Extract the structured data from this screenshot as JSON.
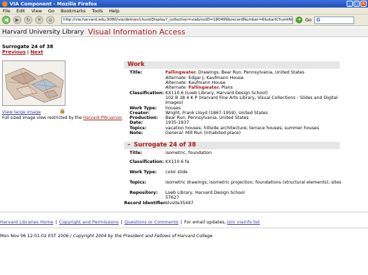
{
  "window": {
    "title": "VIA Component - Mozilla Firefox"
  },
  "menu": [
    "File",
    "Edit",
    "View",
    "Go",
    "Bookmarks",
    "Tools",
    "Help"
  ],
  "toolbar": {
    "url": "http://via.harvard.edu:9080/via/deliver/chunkDisplay?_collection=via&inoID=180499&recordNumber=6&startChunkNum=1&endChunkNum=3&&c",
    "go_label": "Go"
  },
  "header": {
    "library": "Harvard University Library",
    "app": "Visual Information Access"
  },
  "surrogate": {
    "title": "Surrogate 24 of 38",
    "previous": "Previous",
    "separator": "|",
    "next": "Next"
  },
  "thumbnail": {
    "view_large": "View large image",
    "restricted_text": "Full sized image view restricted by the ",
    "restricted_link": "Harvard PIN server"
  },
  "work": {
    "heading": "Work",
    "title_label": "Title:",
    "title_main_red": "Fallingwater.",
    "title_main_rest": " Drawings, Bear Run, Pennsylvania, United States",
    "alt_label": "Alternate:",
    "alt1": " Edgar J. Kaufmann House",
    "alt2": " Kaufmann House",
    "alt3_red": " Fallingwater.",
    "alt3_rest": " Plans",
    "classification_label": "Classification:",
    "classification_1": "KX110.6 (Loeb Library, Harvard Design School)",
    "classification_2": "102 B 38 4 K P (Harvard Fine Arts Library, Visual Collections - Slides and Digital",
    "classification_3": "Images)",
    "work_type_label": "Work Type:",
    "work_type": "houses",
    "creator_label": "Creator:",
    "creator": "Wright, Frank Lloyd (1867-1959), United States",
    "production_label": "Production:",
    "production": "Bear Run, Pennsylvania, United States",
    "date_label": "Date:",
    "date": "1935-1937",
    "topics_label": "Topics:",
    "topics": "vacation houses; hillside architecture; terrace houses; summer houses",
    "note_label": "Note:",
    "note_prefix": "General:",
    "note_rest": " Mill Run (inhabited place)"
  },
  "surrogate_section": {
    "heading": "Surrogate 24 of 38",
    "minus": "–",
    "title_label": "Title:",
    "title": "isometric, foundation",
    "classification_label": "Classification:",
    "classification": "KX110.6 fa",
    "work_type_label": "Work Type:",
    "work_type": "color slide",
    "topics_label": "Topics:",
    "topics": "isometric drawings; isometric projection; foundations (structural elements); sites",
    "repository_label": "Repository:",
    "repository_1": "Loeb Library, Harvard Design School",
    "repository_2": "57627",
    "record_id_label": "Record Identifier:",
    "record_id": "olvsite35447"
  },
  "footer": {
    "home": "Harvard Libraries Home",
    "copyright": "Copyright and Permissions",
    "questions": "Questions or Comments",
    "updates_text": "For email updates, ",
    "updates_link": "join viainfo list",
    "sep": "|",
    "timestamp": "Mon Nov 06 12:01:02 EST 2006",
    "copyright_line": " / Copyright 2004 by the President and Fellows of Harvard College"
  },
  "colors": {
    "accent_red": "#a51c1c",
    "link_blue": "#3939a5"
  }
}
